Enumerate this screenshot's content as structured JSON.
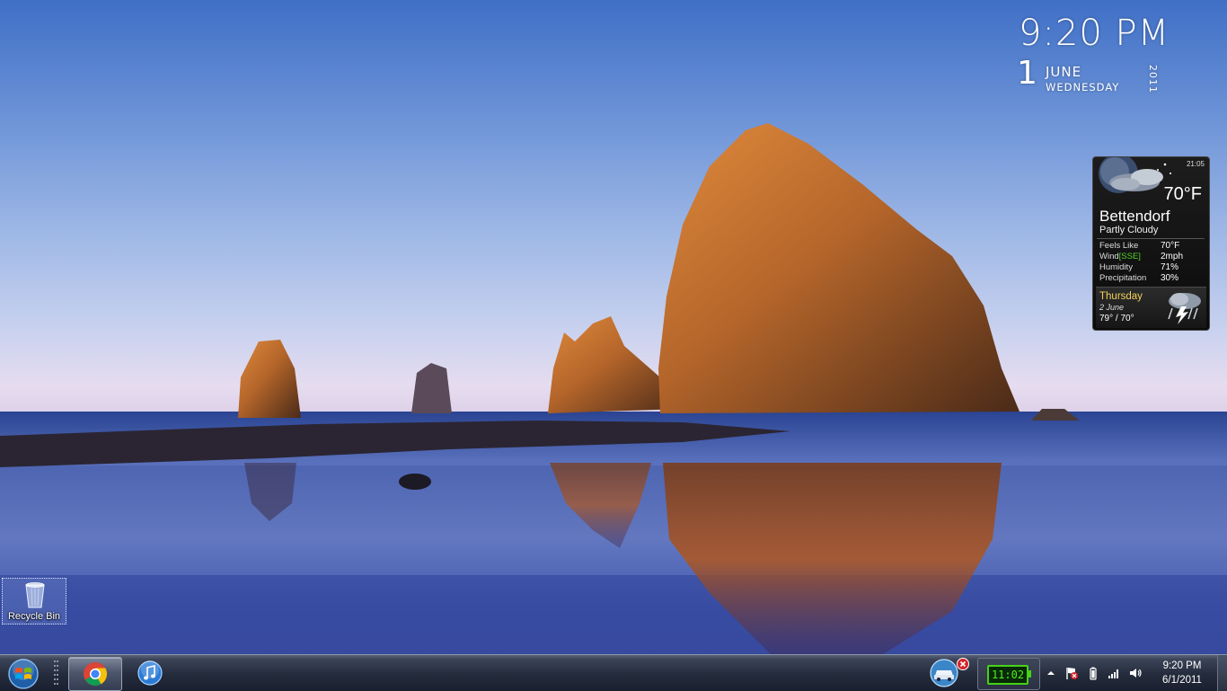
{
  "desktop": {
    "recycle_bin_label": "Recycle Bin"
  },
  "clock_gadget": {
    "time": "9:20 PM",
    "day": "1",
    "month": "JUNE",
    "weekday": "WEDNESDAY",
    "year": "2011"
  },
  "weather_gadget": {
    "update_time": "21:05",
    "temperature": "70°F",
    "city": "Bettendorf",
    "condition": "Partly Cloudy",
    "details": {
      "feels_like_label": "Feels Like",
      "feels_like_value": "70°F",
      "wind_label": "Wind",
      "wind_direction": "[SSE]",
      "wind_value": "2mph",
      "humidity_label": "Humidity",
      "humidity_value": "71%",
      "precipitation_label": "Precipitation",
      "precipitation_value": "30%"
    },
    "forecast": {
      "day": "Thursday",
      "date": "2 June",
      "temps": "79° / 70°"
    },
    "icons": {
      "current": "partly-cloudy-night-icon",
      "forecast": "thunderstorm-icon"
    }
  },
  "taskbar": {
    "start_icon": "windows-start-orb-icon",
    "pinned": [
      {
        "name": "chrome-icon",
        "active": true
      },
      {
        "name": "itunes-icon",
        "active": false
      }
    ],
    "tray": {
      "app_icon": "car-icon",
      "battery_meter_text": "11:02",
      "icons": [
        "show-hidden-icons-chevron",
        "action-center-flag-icon",
        "power-icon",
        "network-signal-icon",
        "volume-icon"
      ],
      "clock_time": "9:20 PM",
      "clock_date": "6/1/2011"
    },
    "colors": {
      "battery_green": "#46d11a",
      "wind_green": "#56d02b",
      "forecast_yellow": "#f2d15a"
    }
  }
}
